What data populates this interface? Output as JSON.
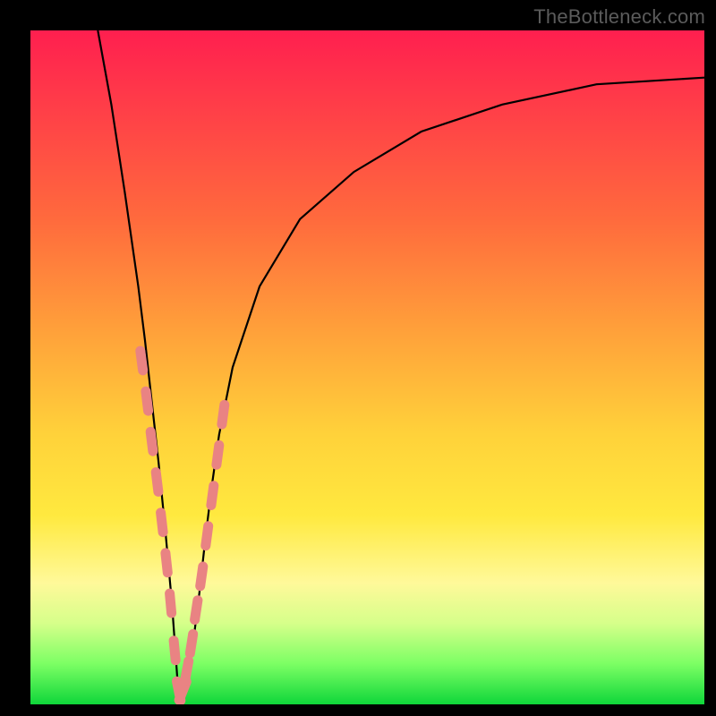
{
  "watermark": "TheBottleneck.com",
  "colors": {
    "frame": "#000000",
    "curve": "#000000",
    "marker_fill": "#e98383",
    "marker_stroke": "#d26868",
    "gradient_stops": [
      "#ff1f4f",
      "#ff3a49",
      "#ff6a3d",
      "#ffa23a",
      "#ffd23a",
      "#ffe93f",
      "#fff99a",
      "#d6ff8a",
      "#7cff64",
      "#0fd63a"
    ]
  },
  "chart_data": {
    "type": "line",
    "title": "",
    "xlabel": "",
    "ylabel": "",
    "xlim": [
      0,
      100
    ],
    "ylim": [
      0,
      100
    ],
    "grid": false,
    "legend": false,
    "note": "V-shaped bottleneck curve; minimum ≈ x 22, y 0. Values are percent of plot width/height; y=100 is top, y=0 is bottom.",
    "series": [
      {
        "name": "bottleneck-curve",
        "x": [
          10,
          12,
          14,
          16,
          17,
          18,
          19,
          20,
          21,
          22,
          23,
          24,
          25,
          26,
          27,
          28,
          30,
          34,
          40,
          48,
          58,
          70,
          84,
          100
        ],
        "y": [
          100,
          89,
          76,
          62,
          54,
          45,
          36,
          26,
          15,
          1,
          2,
          8,
          16,
          25,
          33,
          40,
          50,
          62,
          72,
          79,
          85,
          89,
          92,
          93
        ]
      }
    ],
    "markers": {
      "name": "highlighted-points",
      "note": "pink pill markers near the trough of the V",
      "x": [
        16.5,
        17.3,
        18.0,
        18.8,
        19.5,
        20.2,
        20.8,
        21.4,
        22.0,
        22.6,
        23.2,
        23.9,
        24.6,
        25.4,
        26.2,
        27.0,
        27.8,
        28.6
      ],
      "y": [
        51,
        45,
        39,
        33,
        27,
        21,
        15,
        8,
        2,
        2,
        5,
        9,
        14,
        19,
        25,
        31,
        37,
        43
      ]
    }
  }
}
